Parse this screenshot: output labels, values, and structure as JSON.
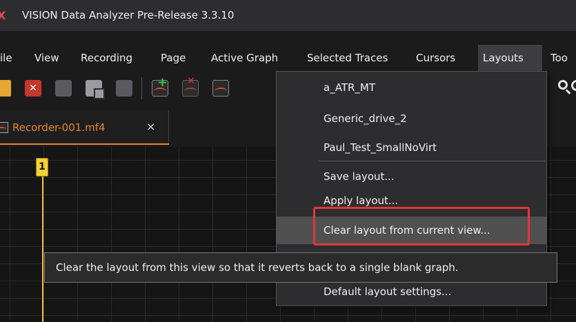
{
  "window": {
    "title": "VISION Data Analyzer Pre-Release 3.3.10"
  },
  "menubar": {
    "items": [
      "ile",
      "View",
      "Recording",
      "Page",
      "Active Graph",
      "Selected Traces",
      "Cursors",
      "Layouts",
      "Too"
    ],
    "active": "Layouts"
  },
  "toolbar": {
    "icons": [
      "open-folder-icon",
      "close-recording-icon",
      "save-icon",
      "save-as-icon",
      "save-all-icon",
      "add-trace-icon",
      "remove-trace-icon",
      "trace-options-icon",
      "zoom-icon"
    ],
    "close_glyph": "✕"
  },
  "tabs": [
    {
      "label": "Recorder-001.mf4",
      "close_glyph": "×"
    }
  ],
  "graph": {
    "cursor_label": "1",
    "cursor_color": "#f2c438"
  },
  "layouts_menu": {
    "items": [
      "a_ATR_MT",
      "Generic_drive_2",
      "Paul_Test_SmallNoVirt",
      "Save layout...",
      "Apply layout...",
      "Clear layout from current view...",
      "Default layout settings..."
    ],
    "hovered": "Clear layout from current view..."
  },
  "tooltip": {
    "text": "Clear the layout from this view so that it reverts back to a single blank graph."
  },
  "colors": {
    "accent_tab": "#e8872a",
    "highlight": "#e5363a",
    "cursor": "#f2c438"
  }
}
